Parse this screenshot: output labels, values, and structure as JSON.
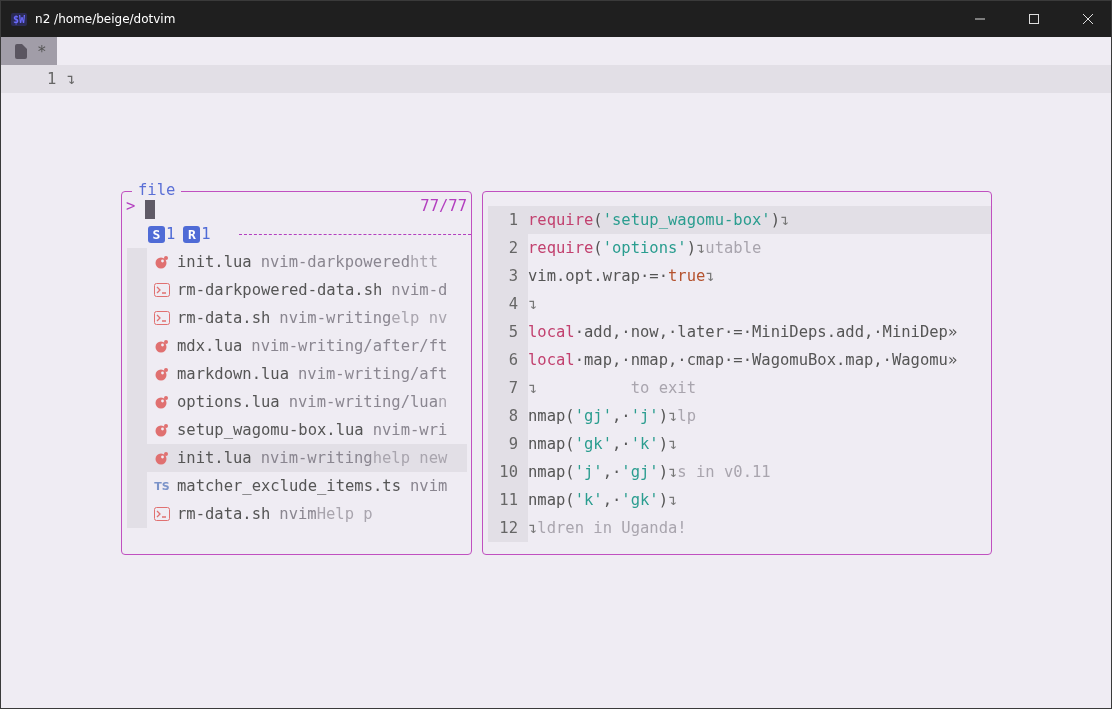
{
  "window": {
    "title": "n2 /home/beige/dotvim",
    "app_icon": "$W"
  },
  "tabs": [
    {
      "label": "*",
      "selected": true
    }
  ],
  "editor": {
    "lines": [
      {
        "number": "1",
        "eol": "↴"
      }
    ]
  },
  "picker": {
    "title": "file",
    "prompt": ">",
    "count": "77/77",
    "badges": [
      {
        "letter": "S",
        "count": "1"
      },
      {
        "letter": "R",
        "count": "1"
      }
    ],
    "items": [
      {
        "kind": "lua",
        "name": "init.lua",
        "path": "nvim-darkpowered",
        "ghost": "htt",
        "selected": false
      },
      {
        "kind": "shell",
        "name": "rm-darkpowered-data.sh",
        "path": "nvim-d",
        "selected": false
      },
      {
        "kind": "shell",
        "name": "rm-data.sh",
        "path": "nvim-writing",
        "ghost": "elp nv",
        "selected": false
      },
      {
        "kind": "lua",
        "name": "mdx.lua",
        "path": "nvim-writing/after/ft",
        "selected": false
      },
      {
        "kind": "lua",
        "name": "markdown.lua",
        "path": "nvim-writing/aft",
        "selected": false
      },
      {
        "kind": "lua",
        "name": "options.lua",
        "path": "nvim-writing/lua",
        "ghost": "n",
        "selected": false
      },
      {
        "kind": "lua",
        "name": "setup_wagomu-box.lua",
        "path": "nvim-wri",
        "selected": false
      },
      {
        "kind": "lua",
        "name": "init.lua",
        "path": "nvim-writing",
        "ghost": "help new",
        "selected": true
      },
      {
        "kind": "ts",
        "icon_text": "TS",
        "name": "matcher_exclude_items.ts",
        "path": "nvim",
        "selected": false
      },
      {
        "kind": "shell",
        "name": "rm-data.sh",
        "path": "nvim",
        "ghost": "Help p",
        "selected": false
      }
    ]
  },
  "preview": {
    "lines": [
      {
        "number": "1",
        "current": true,
        "segments": [
          {
            "kind": "keyword",
            "text": "require"
          },
          {
            "kind": "plain",
            "text": "("
          },
          {
            "kind": "string",
            "text": "'setup_wagomu-box'"
          },
          {
            "kind": "plain",
            "text": ")"
          },
          {
            "kind": "eol",
            "text": "↴"
          }
        ]
      },
      {
        "number": "2",
        "current": false,
        "segments": [
          {
            "kind": "keyword",
            "text": "require"
          },
          {
            "kind": "plain",
            "text": "("
          },
          {
            "kind": "string",
            "text": "'options'"
          },
          {
            "kind": "plain",
            "text": ")"
          },
          {
            "kind": "eol",
            "text": "↴"
          },
          {
            "kind": "ghost",
            "text": "utable"
          }
        ]
      },
      {
        "number": "3",
        "current": false,
        "segments": [
          {
            "kind": "plain",
            "text": "vim.opt.wrap·=·"
          },
          {
            "kind": "boolean",
            "text": "true"
          },
          {
            "kind": "eol",
            "text": "↴"
          }
        ]
      },
      {
        "number": "4",
        "current": false,
        "segments": [
          {
            "kind": "eol",
            "text": "↴"
          }
        ]
      },
      {
        "number": "5",
        "current": false,
        "segments": [
          {
            "kind": "keyword",
            "text": "local"
          },
          {
            "kind": "plain",
            "text": "·add,·now,·later·=·MiniDeps.add,·MiniDep»"
          }
        ]
      },
      {
        "number": "6",
        "current": false,
        "segments": [
          {
            "kind": "keyword",
            "text": "local"
          },
          {
            "kind": "plain",
            "text": "·map,·nmap,·cmap·=·WagomuBox.map,·Wagomu»"
          }
        ]
      },
      {
        "number": "7",
        "current": false,
        "segments": [
          {
            "kind": "eol",
            "text": "↴"
          },
          {
            "kind": "ghost",
            "text": "          to exit"
          }
        ]
      },
      {
        "number": "8",
        "current": false,
        "segments": [
          {
            "kind": "plain",
            "text": "nmap("
          },
          {
            "kind": "string",
            "text": "'gj'"
          },
          {
            "kind": "plain",
            "text": ",·"
          },
          {
            "kind": "string",
            "text": "'j'"
          },
          {
            "kind": "plain",
            "text": ")"
          },
          {
            "kind": "eol",
            "text": "↴"
          },
          {
            "kind": "ghost",
            "text": "lp"
          }
        ]
      },
      {
        "number": "9",
        "current": false,
        "segments": [
          {
            "kind": "plain",
            "text": "nmap("
          },
          {
            "kind": "string",
            "text": "'gk'"
          },
          {
            "kind": "plain",
            "text": ",·"
          },
          {
            "kind": "string",
            "text": "'k'"
          },
          {
            "kind": "plain",
            "text": ")"
          },
          {
            "kind": "eol",
            "text": "↴"
          }
        ]
      },
      {
        "number": "10",
        "current": false,
        "segments": [
          {
            "kind": "plain",
            "text": "nmap("
          },
          {
            "kind": "string",
            "text": "'j'"
          },
          {
            "kind": "plain",
            "text": ",·"
          },
          {
            "kind": "string",
            "text": "'gj'"
          },
          {
            "kind": "plain",
            "text": ")"
          },
          {
            "kind": "eol",
            "text": "↴"
          },
          {
            "kind": "ghost",
            "text": "s in v0.11"
          }
        ]
      },
      {
        "number": "11",
        "current": false,
        "segments": [
          {
            "kind": "plain",
            "text": "nmap("
          },
          {
            "kind": "string",
            "text": "'k'"
          },
          {
            "kind": "plain",
            "text": ",·"
          },
          {
            "kind": "string",
            "text": "'gk'"
          },
          {
            "kind": "plain",
            "text": ")"
          },
          {
            "kind": "eol",
            "text": "↴"
          }
        ]
      },
      {
        "number": "12",
        "current": false,
        "segments": [
          {
            "kind": "eol",
            "text": "↴"
          },
          {
            "kind": "ghost",
            "text": "ldren in Uganda!"
          }
        ]
      }
    ]
  }
}
